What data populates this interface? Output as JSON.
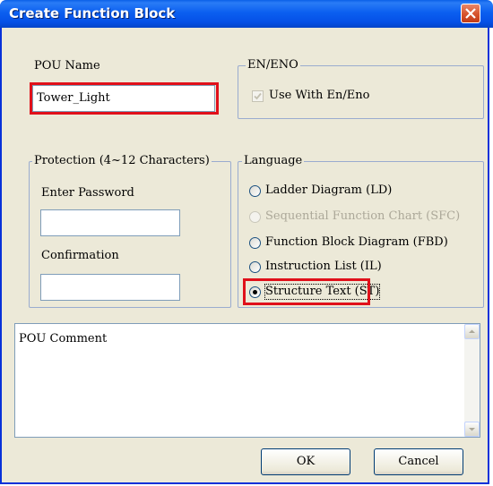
{
  "window": {
    "title": "Create Function Block"
  },
  "pou": {
    "label": "POU Name",
    "value": "Tower_Light"
  },
  "en_eno": {
    "label": "EN/ENO",
    "checkbox_label": "Use With En/Eno",
    "checked": true,
    "disabled": true
  },
  "protection": {
    "label": "Protection (4~12 Characters)",
    "password_label": "Enter Password",
    "password_value": "",
    "confirm_label": "Confirmation",
    "confirm_value": ""
  },
  "language": {
    "label": "Language",
    "options": [
      {
        "label": "Ladder Diagram (LD)",
        "selected": false,
        "disabled": false
      },
      {
        "label": "Sequential Function Chart (SFC)",
        "selected": false,
        "disabled": true
      },
      {
        "label": "Function Block Diagram (FBD)",
        "selected": false,
        "disabled": false
      },
      {
        "label": "Instruction List (IL)",
        "selected": false,
        "disabled": false
      },
      {
        "label": "Structure Text (ST)",
        "selected": true,
        "disabled": false
      }
    ]
  },
  "comment": {
    "label": "POU Comment"
  },
  "buttons": {
    "ok": "OK",
    "cancel": "Cancel"
  },
  "colors": {
    "highlight": "#e0101a",
    "title_bar": "#0b5ff0"
  }
}
